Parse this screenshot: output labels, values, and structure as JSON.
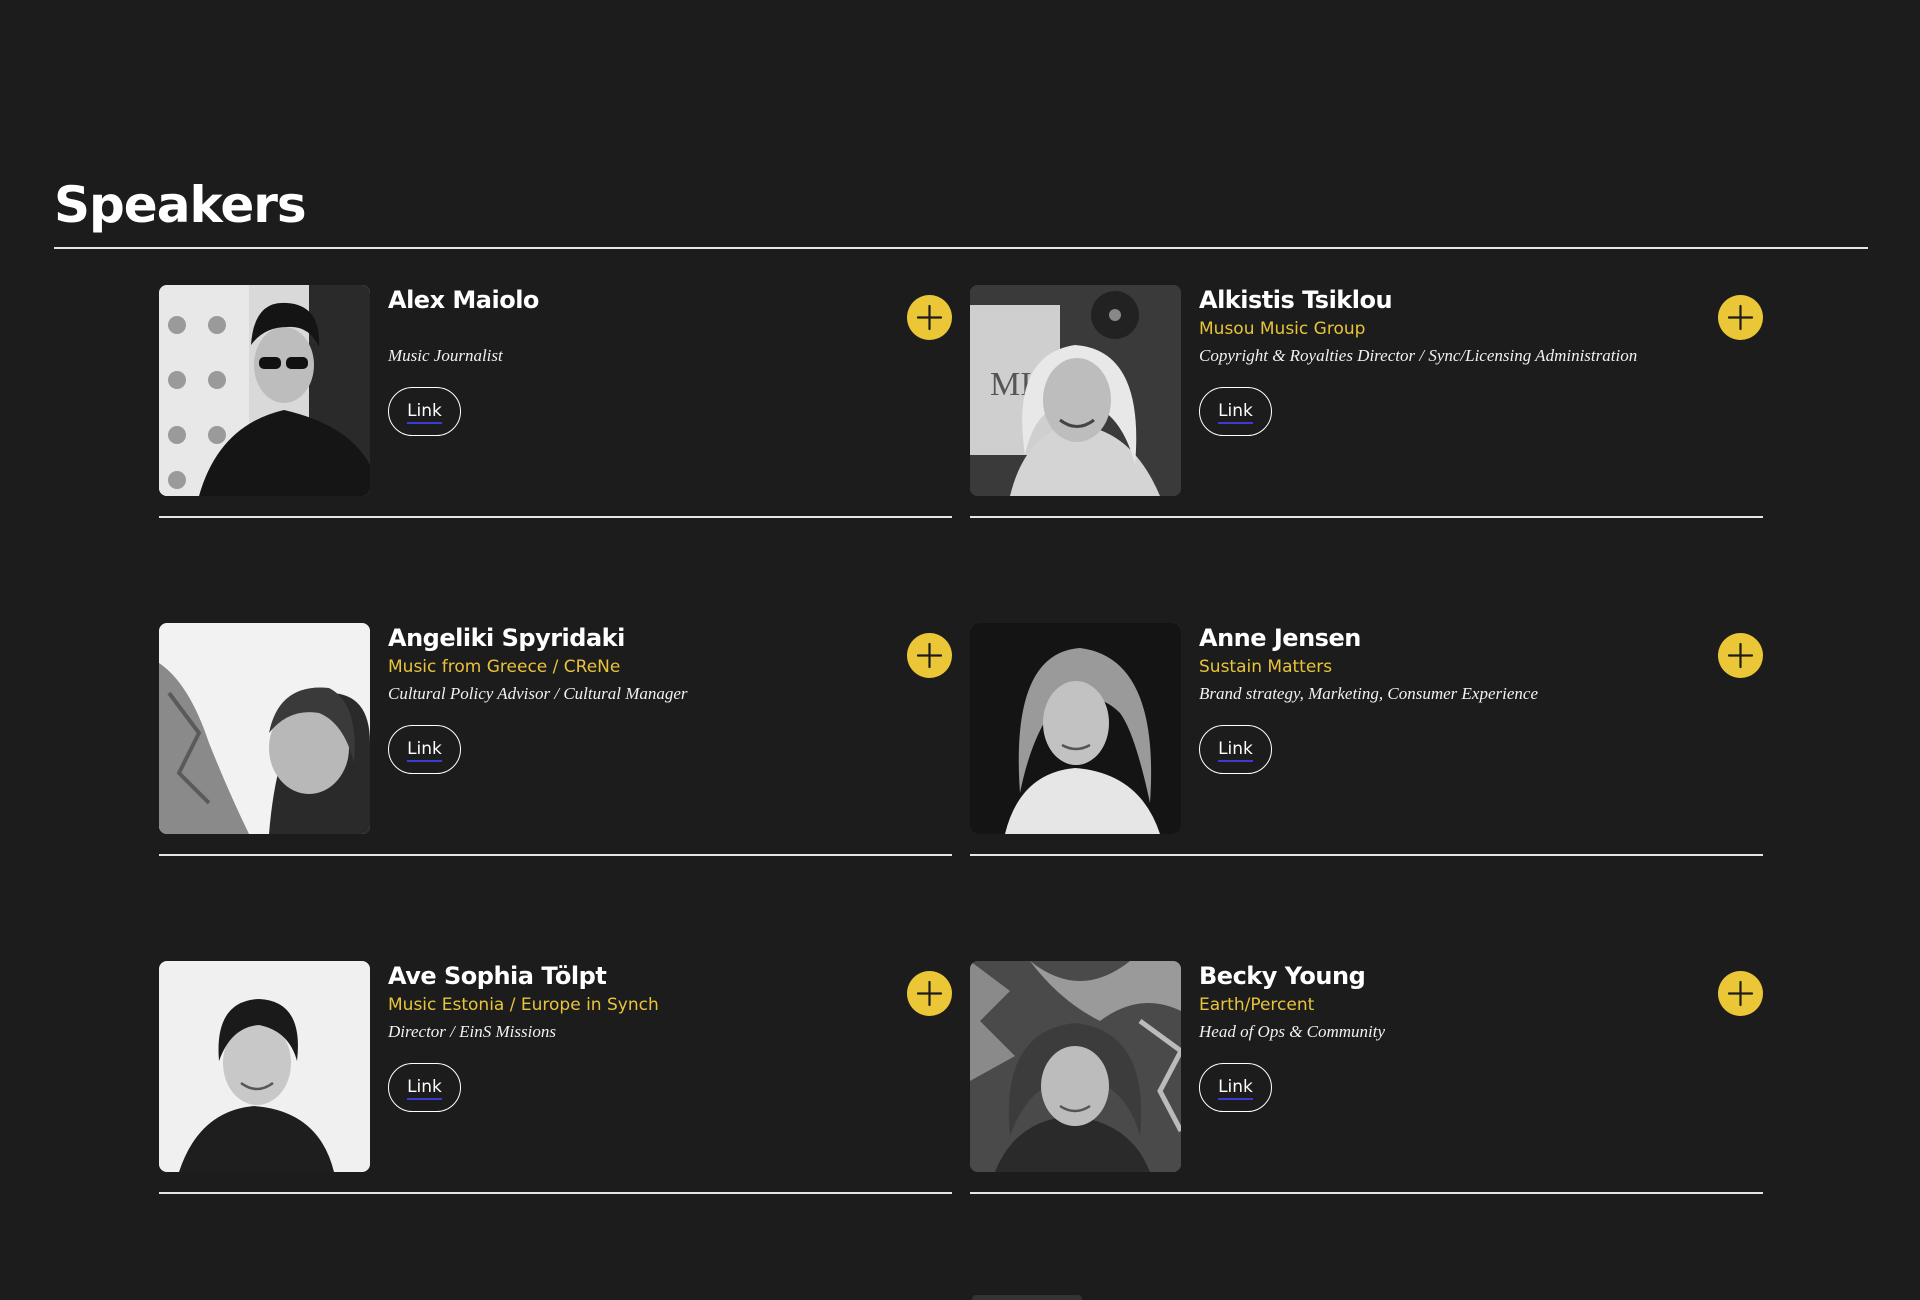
{
  "section": {
    "title": "Speakers"
  },
  "colors": {
    "background": "#1c1c1c",
    "accent": "#ebc637",
    "org_text": "#e8c43a",
    "rule": "#e6e6e6"
  },
  "icons": {
    "expand": "plus-icon"
  },
  "speakers": [
    {
      "name": "Alex Maiolo",
      "org": "",
      "role": "Music Journalist",
      "link_label": "Link"
    },
    {
      "name": "Alkistis Tsiklou",
      "org": "Musou Music Group",
      "role": "Copyright & Royalties Director / Sync/Licensing Administration",
      "link_label": "Link"
    },
    {
      "name": "Angeliki Spyridaki",
      "org": "Music from Greece / CReNe",
      "role": "Cultural Policy Advisor / Cultural Manager",
      "link_label": "Link"
    },
    {
      "name": "Anne Jensen",
      "org": "Sustain Matters",
      "role": "Brand strategy, Marketing, Consumer Experience",
      "link_label": "Link"
    },
    {
      "name": "Ave Sophia Tölpt",
      "org": "Music Estonia / Europe in Synch",
      "role": "Director / EinS Missions",
      "link_label": "Link"
    },
    {
      "name": "Becky Young",
      "org": "Earth/Percent",
      "role": "Head of Ops & Community",
      "link_label": "Link"
    }
  ]
}
